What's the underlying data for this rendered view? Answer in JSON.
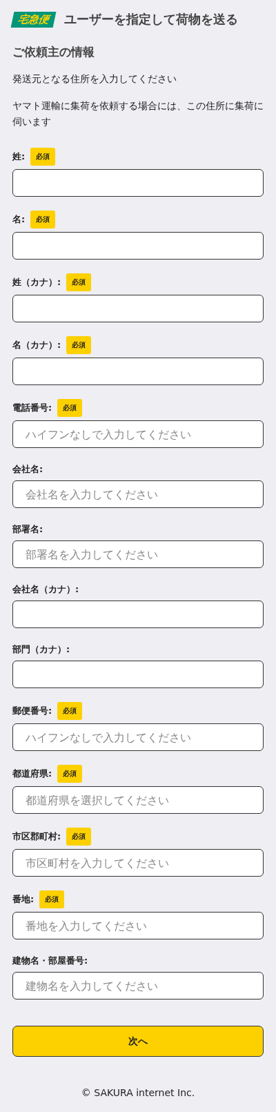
{
  "header": {
    "logo": "宅急便",
    "title": "ユーザーを指定して荷物を送る"
  },
  "section_title": "ご依頼主の情報",
  "notes": [
    "発送元となる住所を入力してください",
    "ヤマト運輸に集荷を依頼する場合には、この住所に集荷に伺います"
  ],
  "fields": [
    {
      "label": "姓:",
      "badge": "必須"
    },
    {
      "label": "名:",
      "badge": "必須"
    },
    {
      "label": "姓（カナ）:",
      "badge": "必須"
    },
    {
      "label": "名（カナ）:",
      "badge": "必須"
    },
    {
      "label": "電話番号:",
      "badge": "必須",
      "placeholder": "ハイフンなしで入力してください"
    },
    {
      "label": "会社名:",
      "placeholder": "会社名を入力してください"
    },
    {
      "label": "部署名:",
      "placeholder": "部署名を入力してください"
    },
    {
      "label": "会社名（カナ）:"
    },
    {
      "label": "部門（カナ）:"
    },
    {
      "label": "郵便番号:",
      "badge": "必須",
      "placeholder": "ハイフンなしで入力してください"
    },
    {
      "label": "都道府県:",
      "badge": "必須",
      "placeholder": "都道府県を選択してください"
    },
    {
      "label": "市区郡町村:",
      "badge": "必須",
      "placeholder": "市区町村を入力してください"
    },
    {
      "label": "番地:",
      "badge": "必須",
      "placeholder": "番地を入力してください"
    },
    {
      "label": "建物名・部屋番号:",
      "placeholder": "建物名を入力してください"
    }
  ],
  "next_button": "次へ",
  "footer": "© SAKURA internet Inc."
}
